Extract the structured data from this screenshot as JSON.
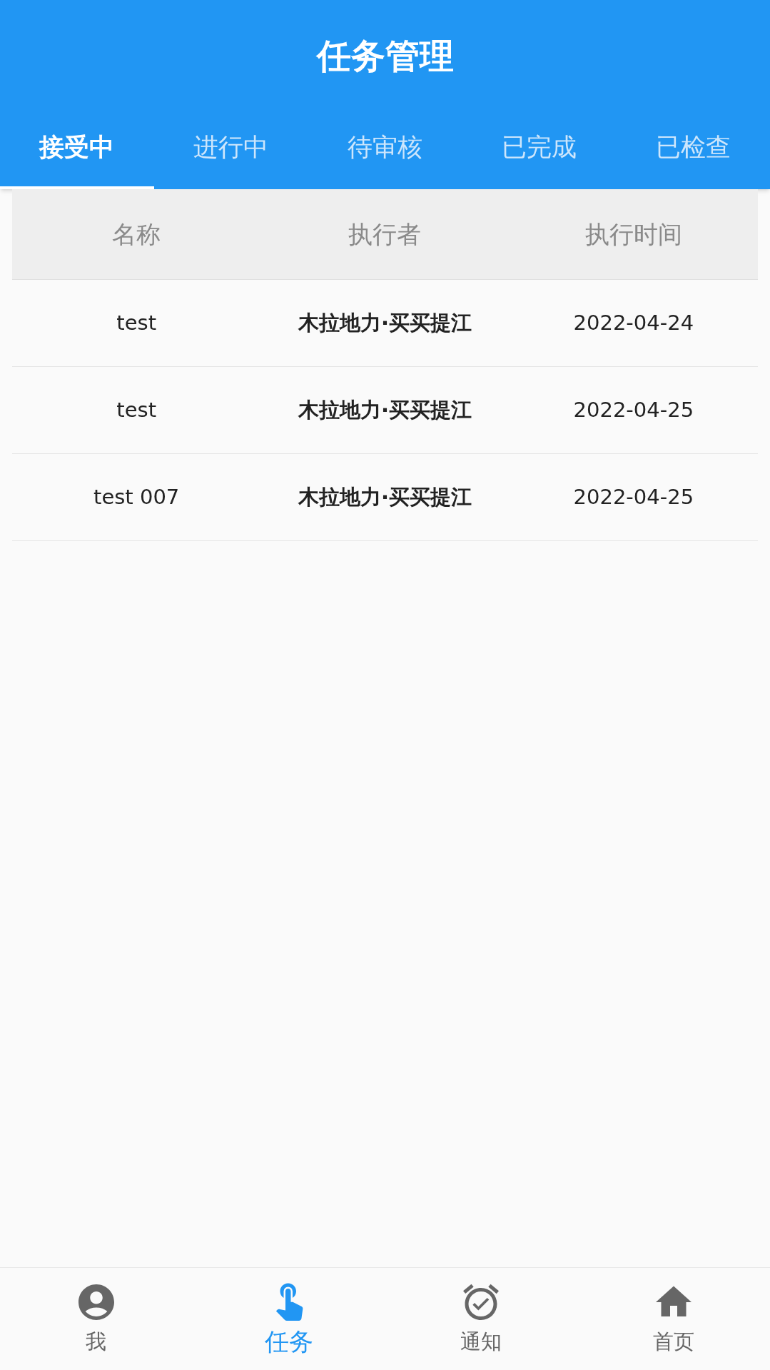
{
  "app_bar": {
    "title": "任务管理"
  },
  "tabs": [
    {
      "label": "接受中",
      "selected": true
    },
    {
      "label": "进行中",
      "selected": false
    },
    {
      "label": "待审核",
      "selected": false
    },
    {
      "label": "已完成",
      "selected": false
    },
    {
      "label": "已检查",
      "selected": false
    }
  ],
  "table": {
    "columns": [
      "名称",
      "执行者",
      "执行时间"
    ],
    "rows": [
      [
        "test",
        "木拉地力·买买提江",
        "2022-04-24"
      ],
      [
        "test",
        "木拉地力·买买提江",
        "2022-04-25"
      ],
      [
        "test 007",
        "木拉地力·买买提江",
        "2022-04-25"
      ]
    ]
  },
  "bottom_nav": [
    {
      "kind": "person",
      "label": "我",
      "selected": false
    },
    {
      "kind": "touch",
      "label": "任务",
      "selected": true
    },
    {
      "kind": "alarm",
      "label": "通知",
      "selected": false
    },
    {
      "kind": "home",
      "label": "首页",
      "selected": false
    }
  ]
}
